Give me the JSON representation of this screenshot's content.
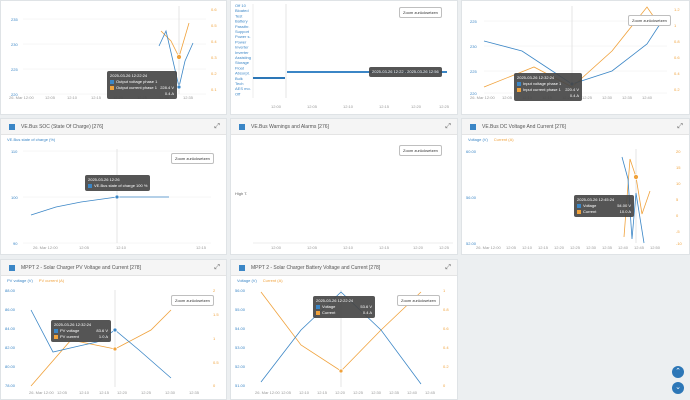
{
  "colors": {
    "blue": "#3b86c6",
    "orange": "#f0a23c",
    "accent": "#2d77b7"
  },
  "buttons": {
    "zoom_reset": "Zoom zurücksetzen"
  },
  "panels": {
    "top_left": {
      "y_left": [
        "235",
        "230",
        "225",
        "220"
      ],
      "y_right": [
        "0.6",
        "0.5",
        "0.4",
        "0.3",
        "0.2",
        "0.1"
      ],
      "x_ticks": [
        "26. Mar 12:00",
        "12:05",
        "12:10",
        "12:15",
        "12:20",
        "12:25",
        "12:30",
        "12:35"
      ],
      "tooltip": {
        "date": "2025-03-26 12:22:24",
        "rows": [
          {
            "label": "Output voltage phase 1",
            "value": "228.4 V"
          },
          {
            "label": "Output current phase 1",
            "value": "0.4 A"
          }
        ]
      }
    },
    "top_middle": {
      "labels": [
        "Off 10",
        "Bloated",
        "Test",
        "Battery",
        "Passthr.",
        "Support",
        "Power s.",
        "Power",
        "Inverter",
        "Inverter",
        "Assisting",
        "Storage",
        "Float",
        "Absorpt.",
        "Bulk",
        "Tech",
        "AES mo.",
        "Off"
      ],
      "x_ticks": [
        "12:00",
        "12:05",
        "12:10",
        "12:15",
        "12:20",
        "12:25"
      ],
      "tooltip": "2025-03-26 12:22 - 2025-03-26 12:56"
    },
    "top_right": {
      "y_left": [
        "225",
        "230",
        "225",
        "220"
      ],
      "y_right": [
        "1.2",
        "1",
        "0.8",
        "0.6",
        "0.4",
        "0.2"
      ],
      "x_ticks": [
        "26. Mar 12:00",
        "12:05",
        "12:10",
        "12:15",
        "12:20",
        "12:25",
        "12:30",
        "12:35",
        "12:40"
      ],
      "tooltip": {
        "date": "2025-03-26 12:32:24",
        "rows": [
          {
            "label": "Input voltage phase 1",
            "value": "220.4 V"
          },
          {
            "label": "Input current phase 1",
            "value": "0.4 A"
          }
        ]
      }
    },
    "soc": {
      "title": "VE.Bus SOC (State Of Charge) [276]",
      "legend": "VE.Bus state of charge (%)",
      "y_ticks": [
        "110",
        "100",
        "90"
      ],
      "x_ticks": [
        "26. Mar 12:00",
        "12:05",
        "12:10",
        "12:15"
      ],
      "tooltip": {
        "date": "2025-03-26 12:26",
        "rows": [
          {
            "label": "VE.Bus state of charge",
            "value": "100 %"
          }
        ]
      }
    },
    "warnings": {
      "title": "VE.Bus Warnings and Alarms [276]",
      "y_label": "High T.",
      "x_ticks": [
        "12:00",
        "12:05",
        "12:10",
        "12:15",
        "12:20",
        "12:25"
      ]
    },
    "dc": {
      "title": "VE.Bus DC Voltage And Current [276]",
      "legend_a": "Voltage (V)",
      "legend_b": "Current (A)",
      "y_left": [
        "60.00",
        "56.00",
        "52.00"
      ],
      "y_right": [
        "20",
        "15",
        "10",
        "5",
        "0",
        "-5",
        "-10"
      ],
      "x_ticks": [
        "26. Mar 12:00",
        "12:05",
        "12:10",
        "12:15",
        "12:20",
        "12:25",
        "12:30",
        "12:35",
        "12:40",
        "12:45",
        "12:50"
      ],
      "tooltip": {
        "date": "2025-03-26 12:45:24",
        "rows": [
          {
            "label": "Voltage",
            "value": "54.00 V"
          },
          {
            "label": "Current",
            "value": "10.0 A"
          }
        ]
      }
    },
    "pv": {
      "title": "MPPT 2 - Solar Charger PV Voltage and Current [278]",
      "legend_a": "PV voltage (V)",
      "legend_b": "PV current (A)",
      "y_left": [
        "88.00",
        "86.00",
        "84.00",
        "82.00",
        "80.00",
        "78.00"
      ],
      "y_right": [
        "2",
        "1.5",
        "1",
        "0.5",
        "0"
      ],
      "x_ticks": [
        "26. Mar 12:00",
        "12:05",
        "12:10",
        "12:15",
        "12:20",
        "12:25",
        "12:30",
        "12:35"
      ],
      "tooltip": {
        "date": "2025-03-26 12:32:24",
        "rows": [
          {
            "label": "PV voltage",
            "value": "83.6 V"
          },
          {
            "label": "PV current",
            "value": "1.0 A"
          }
        ]
      }
    },
    "battery": {
      "title": "MPPT 2 - Solar Charger Battery Voltage and Current [278]",
      "legend_a": "Voltage (V)",
      "legend_b": "Current (A)",
      "y_left": [
        "56.00",
        "55.00",
        "54.00",
        "53.00",
        "52.00",
        "51.00"
      ],
      "y_right": [
        "1",
        "0.8",
        "0.6",
        "0.4",
        "0.2",
        "0"
      ],
      "x_ticks": [
        "26. Mar 12:00",
        "12:05",
        "12:10",
        "12:15",
        "12:20",
        "12:25",
        "12:30",
        "12:35",
        "12:40",
        "12:45"
      ],
      "tooltip": {
        "date": "2025-03-26 12:22:24",
        "rows": [
          {
            "label": "Voltage",
            "value": "53.6 V"
          },
          {
            "label": "Current",
            "value": "0.4 A"
          }
        ]
      }
    }
  }
}
